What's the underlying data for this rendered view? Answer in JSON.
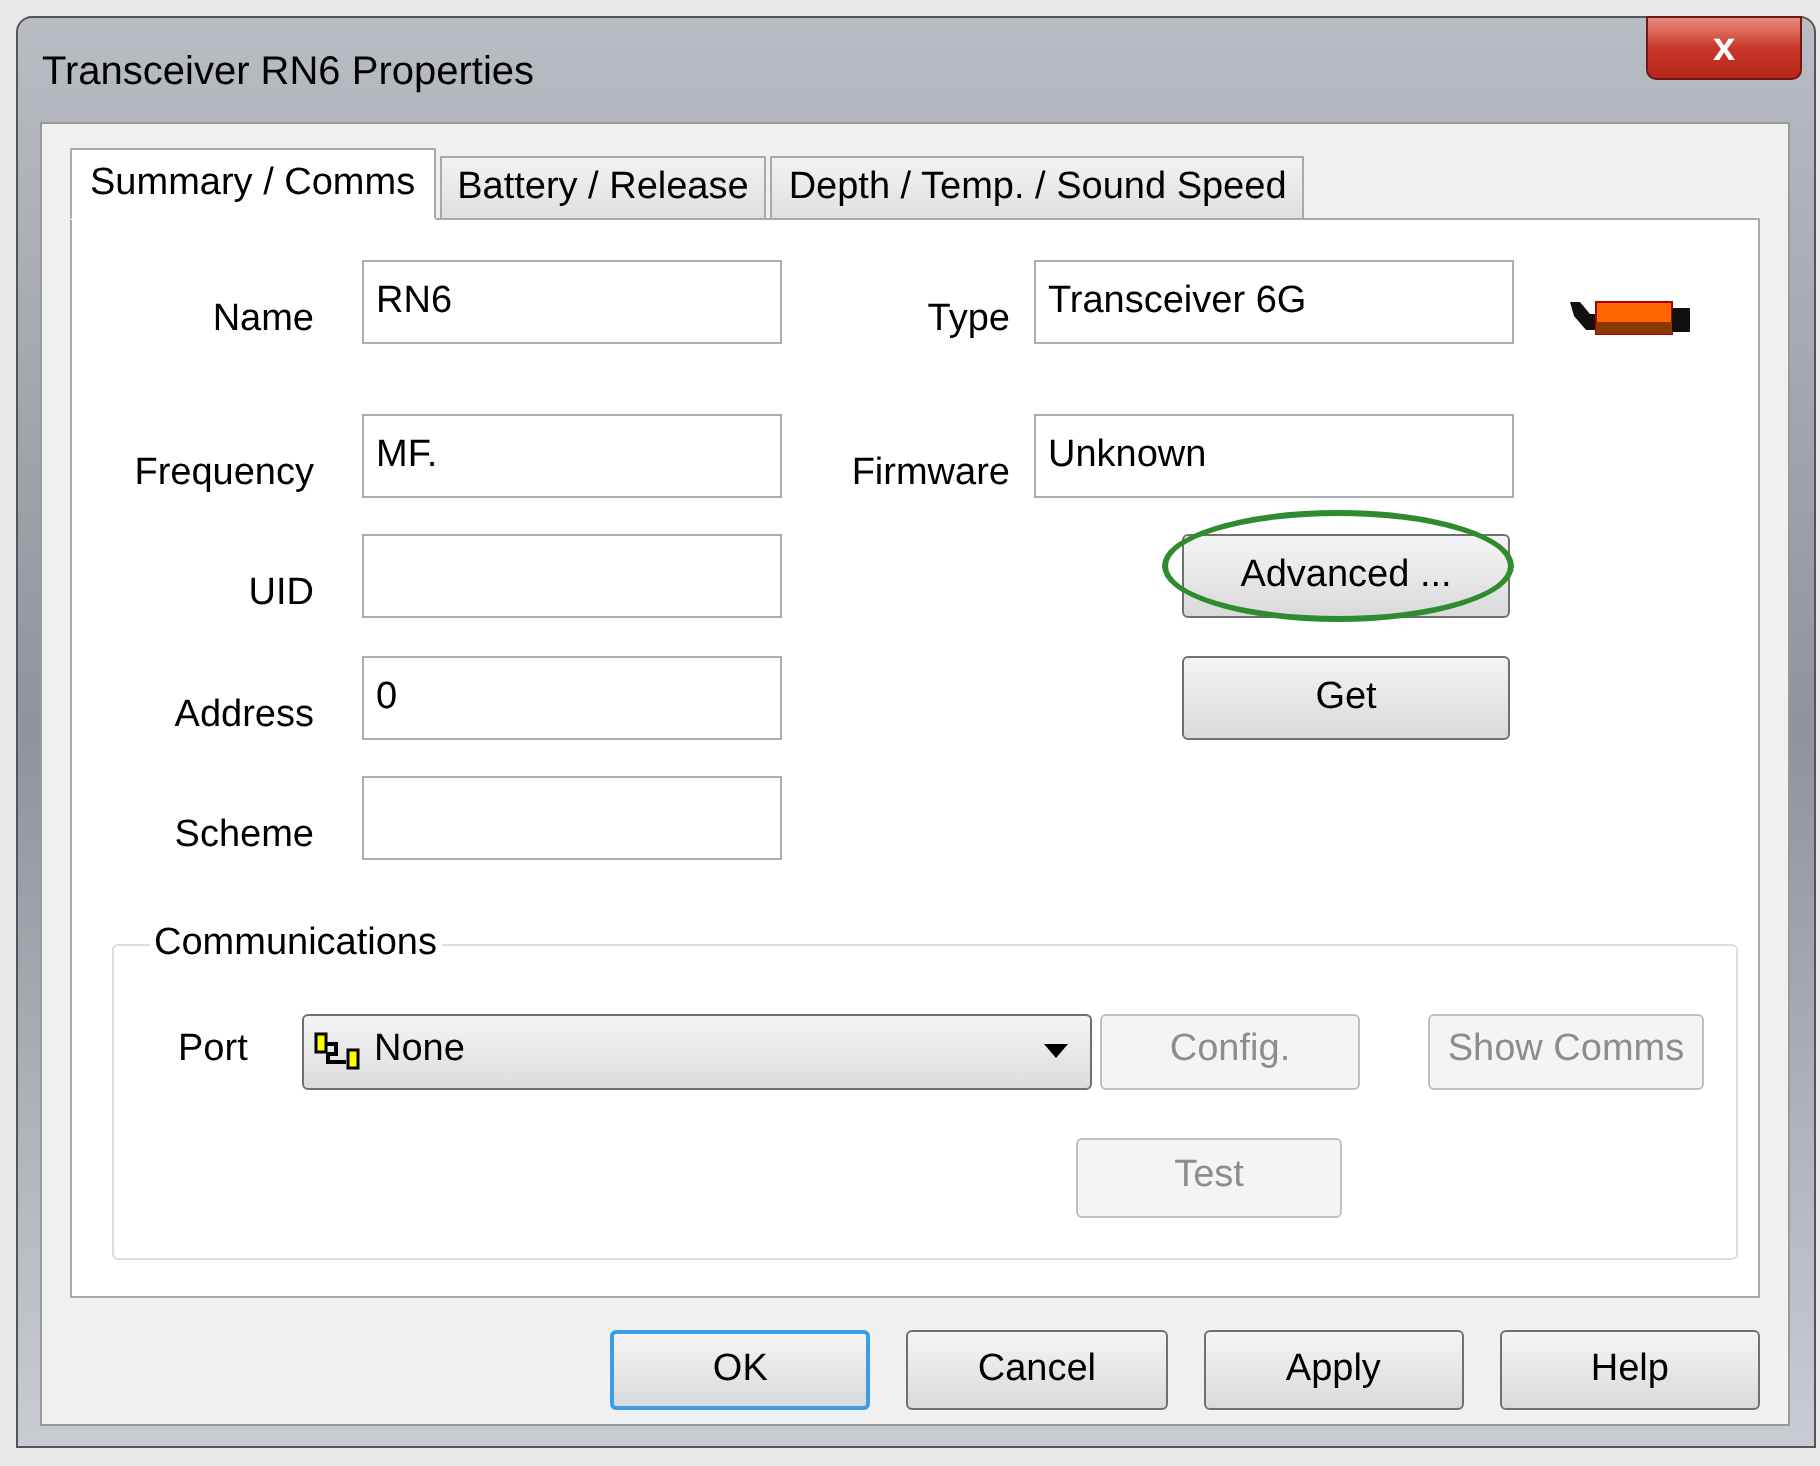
{
  "window": {
    "title": "Transceiver RN6 Properties",
    "close": "x"
  },
  "tabs": [
    {
      "label": "Summary / Comms",
      "selected": true
    },
    {
      "label": "Battery / Release",
      "selected": false
    },
    {
      "label": "Depth / Temp. / Sound Speed",
      "selected": false
    }
  ],
  "left_fields": [
    {
      "label": "Name",
      "value": "RN6"
    },
    {
      "label": "Frequency",
      "value": "MF."
    },
    {
      "label": "UID"
    },
    {
      "label": "Address",
      "value": "0"
    },
    {
      "label": "Scheme"
    }
  ],
  "right_fields": [
    {
      "label": "Type",
      "value": "Transceiver 6G"
    },
    {
      "label": "Firmware",
      "value": "Unknown"
    }
  ],
  "actions": [
    {
      "label": "Advanced ...",
      "highlighted": true
    },
    {
      "label": "Get",
      "highlighted": false
    }
  ],
  "communications": {
    "title": "Communications",
    "port_label": "Port",
    "port_value": "None",
    "buttons": [
      {
        "label": "Config.",
        "disabled": true
      },
      {
        "label": "Show Comms",
        "disabled": true
      },
      {
        "label": "Test",
        "disabled": true
      }
    ]
  },
  "buttons": [
    {
      "label": "OK",
      "default": true
    },
    {
      "label": "Cancel",
      "default": false
    },
    {
      "label": "Apply",
      "default": false
    },
    {
      "label": "Help",
      "default": false
    }
  ]
}
